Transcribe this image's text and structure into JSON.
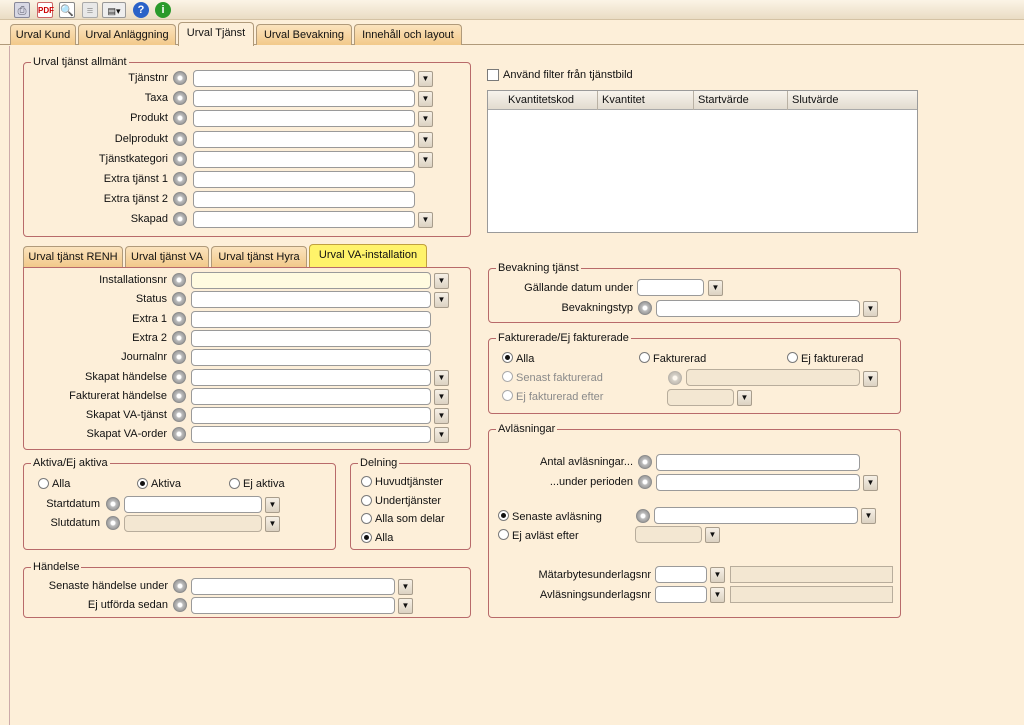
{
  "toolbar": {
    "icons": [
      "printer-icon",
      "pdf-icon",
      "print-preview-icon",
      "document-icon",
      "export-dropdown-icon",
      "help-icon",
      "info-icon"
    ]
  },
  "tabs": [
    "Urval Kund",
    "Urval Anläggning",
    "Urval Tjänst",
    "Urval Bevakning",
    "Innehåll och layout"
  ],
  "active_tab": "Urval Tjänst",
  "general": {
    "legend": "Urval tjänst allmänt",
    "fields": [
      "Tjänstnr",
      "Taxa",
      "Produkt",
      "Delprodukt",
      "Tjänstkategori",
      "Extra tjänst 1",
      "Extra tjänst 2",
      "Skapad"
    ]
  },
  "filter_checkbox": "Använd filter från tjänstbild",
  "grid_columns": [
    "Kvantitetskod",
    "Kvantitet",
    "Startvärde",
    "Slutvärde"
  ],
  "sub_tabs": [
    "Urval tjänst RENH",
    "Urval tjänst VA",
    "Urval tjänst Hyra",
    "Urval VA-installation"
  ],
  "active_sub_tab": "Urval VA-installation",
  "va_install": {
    "fields": [
      "Installationsnr",
      "Status",
      "Extra 1",
      "Extra 2",
      "Journalnr",
      "Skapat händelse",
      "Fakturerat händelse",
      "Skapat VA-tjänst",
      "Skapat VA-order"
    ]
  },
  "active": {
    "legend": "Aktiva/Ej aktiva",
    "options": [
      "Alla",
      "Aktiva",
      "Ej aktiva"
    ],
    "selected": "Aktiva",
    "start_label": "Startdatum",
    "end_label": "Slutdatum"
  },
  "delning": {
    "legend": "Delning",
    "options": [
      "Huvudtjänster",
      "Undertjänster",
      "Alla som delar",
      "Alla"
    ],
    "selected": "Alla"
  },
  "handelse": {
    "legend": "Händelse",
    "fields": [
      "Senaste händelse under",
      "Ej utförda sedan"
    ]
  },
  "bevakning": {
    "legend": "Bevakning tjänst",
    "date_label": "Gällande datum under",
    "type_label": "Bevakningstyp"
  },
  "fakturerade": {
    "legend": "Fakturerade/Ej fakturerade",
    "options": [
      "Alla",
      "Fakturerad",
      "Ej fakturerad"
    ],
    "selected": "Alla",
    "latest": "Senast fakturerad",
    "not_after": "Ej fakturerad efter"
  },
  "avlasningar": {
    "legend": "Avläsningar",
    "count_label": "Antal avläsningar...",
    "period_label": "...under perioden",
    "latest": "Senaste avläsning",
    "not_after": "Ej avläst efter",
    "meter_label": "Mätarbytesunderlagsnr",
    "reading_label": "Avläsningsunderlagsnr",
    "selected": "Senaste avläsning"
  }
}
